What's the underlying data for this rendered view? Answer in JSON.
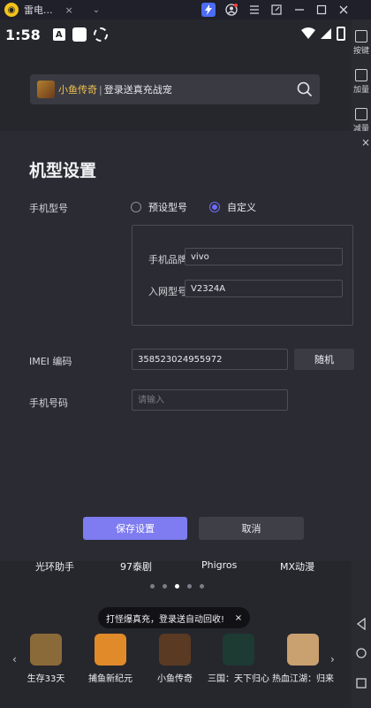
{
  "window": {
    "tab_title": "雷电...",
    "tab_close": "×",
    "tab_chevron": "⌄"
  },
  "status": {
    "time": "1:58",
    "a_badge": "A"
  },
  "search": {
    "game_name": "小鱼传奇",
    "separator": "|",
    "promo": "登录送真充战宠"
  },
  "side_toolbar": {
    "items": [
      {
        "label": "按键"
      },
      {
        "label": "加量"
      },
      {
        "label": "减量"
      }
    ]
  },
  "modal": {
    "title": "机型设置",
    "close": "×",
    "phone_model_label": "手机型号",
    "radio_preset": "预设型号",
    "radio_custom": "自定义",
    "selected_option": "自定义",
    "brand_label": "手机品牌",
    "brand_value": "vivo",
    "model_label": "入网型号",
    "model_value": "V2324A",
    "imei_label": "IMEI 编码",
    "imei_value": "358523024955972",
    "random_button": "随机",
    "phone_number_label": "手机号码",
    "phone_number_placeholder": "请输入",
    "save_button": "保存设置",
    "cancel_button": "取消"
  },
  "app_labels": [
    "光环助手",
    "97泰剧",
    "Phigros",
    "MX动漫"
  ],
  "pager": {
    "count": 5,
    "active_index": 2
  },
  "toast": {
    "text": "打怪爆真充，登录送自动回收!",
    "close": "×"
  },
  "games": [
    {
      "name": "生存33天",
      "color": "#8b6a3a"
    },
    {
      "name": "捕鱼新纪元",
      "color": "#e08a2a"
    },
    {
      "name": "小鱼传奇",
      "color": "#5a3a22"
    },
    {
      "name": "三国：天下归心",
      "color": "#1d3b33"
    },
    {
      "name": "热血江湖：归来",
      "color": "#c9a070"
    }
  ],
  "arrows": {
    "left": "‹",
    "right": "›"
  }
}
